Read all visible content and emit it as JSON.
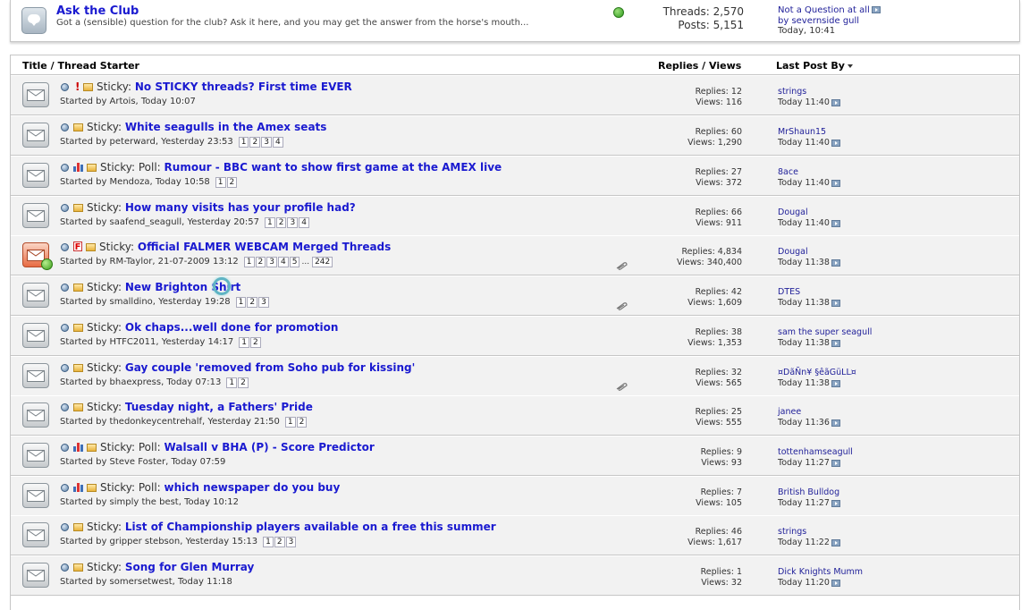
{
  "subforum": {
    "title": "Ask the Club",
    "description": "Got a (sensible) question for the club? Ask it here, and you may get the answer from the horse's mouth...",
    "threads_label": "Threads: 2,570",
    "posts_label": "Posts: 5,151",
    "last_title": "Not a Question at all",
    "last_by": "by severnside gull",
    "last_date": "Today, 10:41"
  },
  "columns": {
    "title": "Title / Thread Starter",
    "replies_views": "Replies / Views",
    "last_post": "Last Post By"
  },
  "threads": [
    {
      "prefix": "Sticky: ",
      "title": "No STICKY threads? First time EVER",
      "starter": "Started by Artois, Today 10:07",
      "pages": [],
      "replies": "Replies: 12",
      "views": "Views: 116",
      "last_user": "strings",
      "last_date": "Today 11:40",
      "icons": [
        "dot",
        "excl",
        "folder"
      ],
      "hot": false,
      "clip": false
    },
    {
      "prefix": "Sticky: ",
      "title": "White seagulls in the Amex seats",
      "starter": "Started by peterward, Yesterday 23:53",
      "pages": [
        "1",
        "2",
        "3",
        "4"
      ],
      "replies": "Replies: 60",
      "views": "Views: 1,290",
      "last_user": "MrShaun15",
      "last_date": "Today 11:40",
      "icons": [
        "dot",
        "folder"
      ],
      "hot": false,
      "clip": false
    },
    {
      "prefix": "Sticky: Poll: ",
      "title": "Rumour - BBC want to show first game at the AMEX live",
      "starter": "Started by Mendoza, Today 10:58",
      "pages": [
        "1",
        "2"
      ],
      "replies": "Replies: 27",
      "views": "Views: 372",
      "last_user": "8ace",
      "last_date": "Today 11:40",
      "icons": [
        "dot",
        "poll",
        "folder"
      ],
      "hot": false,
      "clip": false
    },
    {
      "prefix": "Sticky: ",
      "title": "How many visits has your profile had?",
      "starter": "Started by saafend_seagull, Yesterday 20:57",
      "pages": [
        "1",
        "2",
        "3",
        "4"
      ],
      "replies": "Replies: 66",
      "views": "Views: 911",
      "last_user": "Dougal",
      "last_date": "Today 11:40",
      "icons": [
        "dot",
        "folder"
      ],
      "hot": false,
      "clip": false
    },
    {
      "prefix": "Sticky: ",
      "title": "Official FALMER WEBCAM Merged Threads",
      "starter": "Started by RM-Taylor, 21-07-2009 13:12",
      "pages": [
        "1",
        "2",
        "3",
        "4",
        "5",
        "...",
        "242"
      ],
      "replies": "Replies: 4,834",
      "views": "Views: 340,400",
      "last_user": "Dougal",
      "last_date": "Today 11:38",
      "icons": [
        "dot",
        "f",
        "folder"
      ],
      "hot": true,
      "clip": true
    },
    {
      "prefix": "Sticky: ",
      "title": "New Brighton Shirt",
      "starter": "Started by smalldino, Yesterday 19:28",
      "pages": [
        "1",
        "2",
        "3"
      ],
      "replies": "Replies: 42",
      "views": "Views: 1,609",
      "last_user": "DTES",
      "last_date": "Today 11:38",
      "icons": [
        "dot",
        "folder"
      ],
      "hot": false,
      "clip": true
    },
    {
      "prefix": "Sticky: ",
      "title": "Ok chaps...well done for promotion",
      "starter": "Started by HTFC2011, Yesterday 14:17",
      "pages": [
        "1",
        "2"
      ],
      "replies": "Replies: 38",
      "views": "Views: 1,353",
      "last_user": "sam the super seagull",
      "last_date": "Today 11:38",
      "icons": [
        "dot",
        "folder"
      ],
      "hot": false,
      "clip": false
    },
    {
      "prefix": "Sticky: ",
      "title": "Gay couple 'removed from Soho pub for kissing'",
      "starter": "Started by bhaexpress, Today 07:13",
      "pages": [
        "1",
        "2"
      ],
      "replies": "Replies: 32",
      "views": "Views: 565",
      "last_user": "¤DãÑn¥ §êãGüLL¤",
      "last_date": "Today 11:38",
      "icons": [
        "dot",
        "folder"
      ],
      "hot": false,
      "clip": true
    },
    {
      "prefix": "Sticky: ",
      "title": "Tuesday night, a Fathers' Pride",
      "starter": "Started by thedonkeycentrehalf, Yesterday 21:50",
      "pages": [
        "1",
        "2"
      ],
      "replies": "Replies: 25",
      "views": "Views: 555",
      "last_user": "janee",
      "last_date": "Today 11:36",
      "icons": [
        "dot",
        "folder"
      ],
      "hot": false,
      "clip": false
    },
    {
      "prefix": "Sticky: Poll: ",
      "title": "Walsall v BHA (P) - Score Predictor",
      "starter": "Started by Steve Foster, Today 07:59",
      "pages": [],
      "replies": "Replies: 9",
      "views": "Views: 93",
      "last_user": "tottenhamseagull",
      "last_date": "Today 11:27",
      "icons": [
        "dot",
        "poll",
        "folder"
      ],
      "hot": false,
      "clip": false
    },
    {
      "prefix": "Sticky: Poll: ",
      "title": "which newspaper do you buy",
      "starter": "Started by simply the best, Today 10:12",
      "pages": [],
      "replies": "Replies: 7",
      "views": "Views: 105",
      "last_user": "British Bulldog",
      "last_date": "Today 11:27",
      "icons": [
        "dot",
        "poll",
        "folder"
      ],
      "hot": false,
      "clip": false
    },
    {
      "prefix": "Sticky: ",
      "title": "List of Championship players available on a free this summer",
      "starter": "Started by gripper stebson, Yesterday 15:13",
      "pages": [
        "1",
        "2",
        "3"
      ],
      "replies": "Replies: 46",
      "views": "Views: 1,617",
      "last_user": "strings",
      "last_date": "Today 11:22",
      "icons": [
        "dot",
        "folder"
      ],
      "hot": false,
      "clip": false
    },
    {
      "prefix": "Sticky: ",
      "title": "Song for Glen Murray",
      "starter": "Started by somersetwest, Today 11:18",
      "pages": [],
      "replies": "Replies: 1",
      "views": "Views: 32",
      "last_user": "Dick Knights Mumm",
      "last_date": "Today 11:20",
      "icons": [
        "dot",
        "folder"
      ],
      "hot": false,
      "clip": false
    }
  ]
}
